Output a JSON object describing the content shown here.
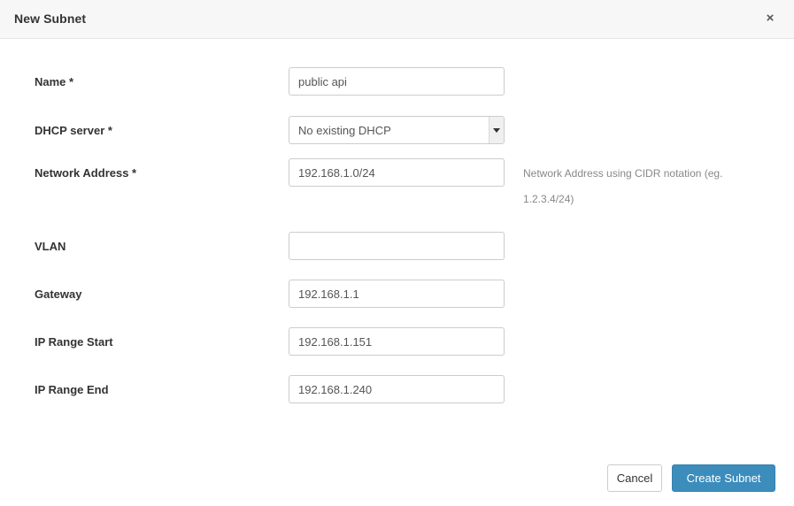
{
  "dialog": {
    "title": "New Subnet",
    "close_label": "×",
    "close_icon": "close-icon"
  },
  "form": {
    "fields": [
      {
        "label": "Name *",
        "type": "text",
        "value": "public api",
        "placeholder": "",
        "help": ""
      },
      {
        "label": "DHCP server *",
        "type": "select",
        "value": "No existing DHCP",
        "placeholder": "",
        "help": "",
        "options": [
          "No existing DHCP"
        ]
      },
      {
        "label": "Network Address *",
        "type": "text",
        "value": "192.168.1.0/24",
        "placeholder": "",
        "help": "Network Address using CIDR notation (eg. 1.2.3.4/24)"
      },
      {
        "label": "VLAN",
        "type": "text",
        "value": "",
        "placeholder": "",
        "help": ""
      },
      {
        "label": "Gateway",
        "type": "text",
        "value": "192.168.1.1",
        "placeholder": "",
        "help": ""
      },
      {
        "label": "IP Range Start",
        "type": "text",
        "value": "192.168.1.151",
        "placeholder": "",
        "help": ""
      },
      {
        "label": "IP Range End",
        "type": "text",
        "value": "192.168.1.240",
        "placeholder": "",
        "help": ""
      }
    ]
  },
  "footer": {
    "cancel_label": "Cancel",
    "submit_label": "Create Subnet"
  },
  "colors": {
    "primary": "#3c8dbc",
    "header_bg": "#f7f7f7",
    "border": "#cccccc",
    "text": "#333333",
    "muted": "#888888"
  }
}
